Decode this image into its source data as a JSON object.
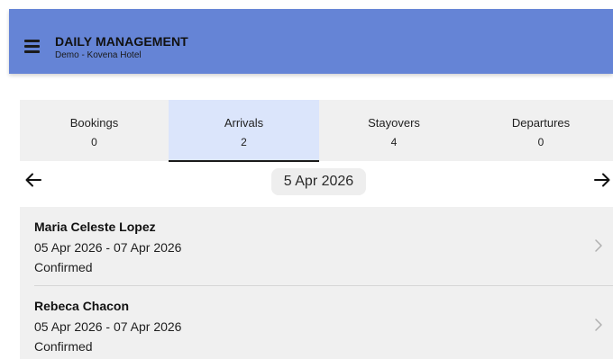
{
  "header": {
    "title": "DAILY MANAGEMENT",
    "subtitle": "Demo - Kovena Hotel",
    "menu_icon": "hamburger-menu-icon",
    "background": "#6584d6"
  },
  "tabs": [
    {
      "label": "Bookings",
      "count": "0",
      "active": false
    },
    {
      "label": "Arrivals",
      "count": "2",
      "active": true
    },
    {
      "label": "Stayovers",
      "count": "4",
      "active": false
    },
    {
      "label": "Departures",
      "count": "0",
      "active": false
    }
  ],
  "date_nav": {
    "date": "5 Apr 2026",
    "prev_icon": "arrow-left-icon",
    "next_icon": "arrow-right-icon"
  },
  "arrivals": [
    {
      "name": "Maria Celeste Lopez",
      "dates": "05 Apr 2026 - 07 Apr 2026",
      "status": "Confirmed",
      "icon": "chevron-right-icon"
    },
    {
      "name": "Rebeca Chacon",
      "dates": "05 Apr 2026 - 07 Apr 2026",
      "status": "Confirmed",
      "icon": "chevron-right-icon"
    }
  ],
  "colors": {
    "active_tab": "#dbe5fb",
    "tab_bg": "#f0f0f0",
    "list_bg": "#f0f0f0"
  }
}
